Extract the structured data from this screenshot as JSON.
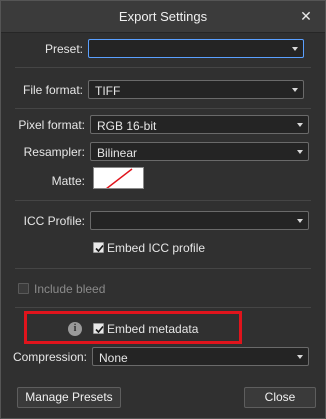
{
  "dialog": {
    "title": "Export Settings",
    "close_glyph": "✕"
  },
  "preset": {
    "label": "Preset:",
    "value": ""
  },
  "file_format": {
    "label": "File format:",
    "value": "TIFF"
  },
  "pixel_format": {
    "label": "Pixel format:",
    "value": "RGB 16-bit"
  },
  "resampler": {
    "label": "Resampler:",
    "value": "Bilinear"
  },
  "matte": {
    "label": "Matte:",
    "color": "#ffffff",
    "slash_color": "#e0141c"
  },
  "icc_profile": {
    "label": "ICC Profile:",
    "value": ""
  },
  "embed_icc": {
    "label": "Embed ICC profile",
    "checked": true
  },
  "include_bleed": {
    "label": "Include bleed",
    "checked": false,
    "enabled": false
  },
  "embed_metadata": {
    "label": "Embed metadata",
    "checked": true,
    "info_icon": "info-icon"
  },
  "compression": {
    "label": "Compression:",
    "value": "None"
  },
  "buttons": {
    "manage_presets": "Manage Presets",
    "close": "Close"
  },
  "colors": {
    "accent_focus": "#5aa0ff",
    "highlight": "#e0141c"
  }
}
